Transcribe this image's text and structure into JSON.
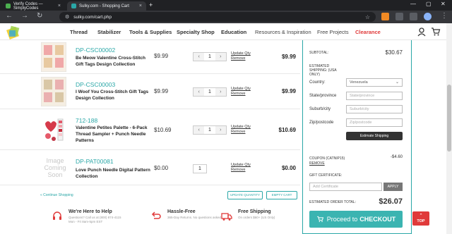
{
  "browser": {
    "tabs": [
      {
        "title": "Verify Codes — SimplyCodes",
        "active": false
      },
      {
        "title": "Sulky.com - Shopping Cart",
        "active": true
      }
    ],
    "url": "sulky.com/cart.php"
  },
  "site": {
    "nav": [
      "Thread",
      "Stabilizer",
      "Tools & Supplies",
      "Specialty Shop",
      "Education",
      "Resources & Inspiration",
      "Free Projects",
      "Clearance"
    ]
  },
  "cart": {
    "items": [
      {
        "sku": "DP-CSC00002",
        "name": "Be Meow Valentine Cross-Stitch Gift Tags Design Collection",
        "price": "$9.99",
        "qty": "1",
        "total": "$9.99",
        "update": "Update Qty",
        "remove": "Remove"
      },
      {
        "sku": "DP-CSC00003",
        "name": "I Woof You Cross-Stitch Gift Tags Design Collection",
        "price": "$9.99",
        "qty": "1",
        "total": "$9.99",
        "update": "Update Qty",
        "remove": "Remove"
      },
      {
        "sku": "712-188",
        "name": "Valentine Petites Palette - 6-Pack Thread Sampler + Punch Needle Patterns",
        "price": "$10.69",
        "qty": "1",
        "total": "$10.69",
        "update": "Update Qty",
        "remove": "Remove"
      },
      {
        "sku": "DP-PAT00081",
        "name": "Love Punch Needle Digital Pattern Collection",
        "price": "$0.00",
        "qty": "1",
        "total": "$0.00",
        "update": "Update Qty",
        "remove": "Remove",
        "image_placeholder": "Image Coming Soon"
      }
    ],
    "continue": "« Continue Shopping",
    "update_quantity": "UPDATE QUANTITY",
    "empty_cart": "EMPTY CART"
  },
  "summary": {
    "subtotal_label": "SUBTOTAL:",
    "subtotal": "$30.67",
    "est_shipping_label": "ESTIMATED SHIPPING: (USA ONLY)",
    "country_label": "Country:",
    "country_value": "Venezuela",
    "state_label": "State/province",
    "state_placeholder": "State/province",
    "suburb_label": "Suburb/city",
    "suburb_placeholder": "Suburb/city",
    "zip_label": "Zip/postcode",
    "zip_placeholder": "Zip/postcode",
    "estimate_button": "Estimate Shipping",
    "coupon_label": "COUPON (CATNIP15)",
    "coupon_value": "-$4.60",
    "coupon_remove": "REMOVE",
    "gift_label": "GIFT CERTIFICATE:",
    "gift_placeholder": "Add Certificate",
    "apply_button": "APPLY",
    "order_total_label": "ESTIMATED ORDER TOTAL:",
    "order_total": "$26.07",
    "checkout_prefix": "Proceed to",
    "checkout_bold": "CHECKOUT"
  },
  "footer": {
    "help_title": "We're Here to Help",
    "help_text": "Questions? Call us at (800) 874-4115 Mon - Fri 8am-5pm EST",
    "returns_title": "Hassle-Free",
    "returns_text": "365-Day Returns. No questions asked.",
    "shipping_title": "Free Shipping",
    "shipping_text": "On orders $60+ (US Only)",
    "top_button": "TOP"
  },
  "colors": {
    "accent": "#2aa7a7",
    "checkout": "#3bb4b1",
    "clearance": "#e03a3a"
  }
}
